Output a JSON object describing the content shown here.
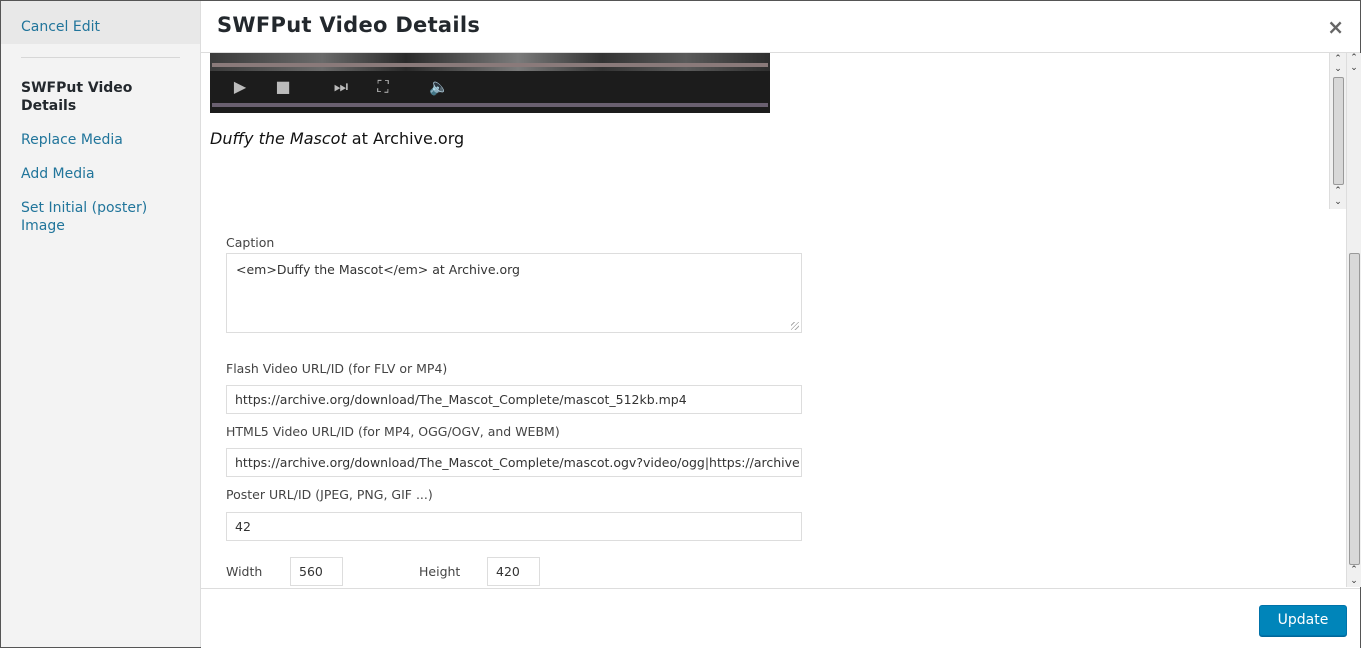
{
  "sidebar": {
    "cancel_label": "Cancel Edit",
    "items": [
      {
        "label": "SWFPut Video Details",
        "active": true
      },
      {
        "label": "Replace Media"
      },
      {
        "label": "Add Media"
      },
      {
        "label": "Set Initial (poster) Image"
      }
    ]
  },
  "header": {
    "title": "SWFPut Video Details",
    "close_glyph": "×"
  },
  "preview": {
    "caption_em": "Duffy the Mascot",
    "caption_rest": " at Archive.org",
    "controls": {
      "play": "▶",
      "stop": "■",
      "skip": "⏭",
      "fullscreen": "⛶",
      "volume": "🔈"
    }
  },
  "form": {
    "caption_label": "Caption",
    "caption_value": "<em>Duffy the Mascot</em> at Archive.org",
    "flash_label": "Flash Video URL/ID (for FLV or MP4)",
    "flash_value": "https://archive.org/download/The_Mascot_Complete/mascot_512kb.mp4",
    "html5_label": "HTML5 Video URL/ID (for MP4, OGG/OGV, and WEBM)",
    "html5_value": "https://archive.org/download/The_Mascot_Complete/mascot.ogv?video/ogg|https://archive.or",
    "poster_label": "Poster URL/ID (JPEG, PNG, GIF ...)",
    "poster_value": "42",
    "width_label": "Width",
    "width_value": "560",
    "height_label": "Height",
    "height_value": "420"
  },
  "footer": {
    "update_label": "Update"
  },
  "scroll_arrows": {
    "up": "⌃",
    "down": "⌄"
  }
}
